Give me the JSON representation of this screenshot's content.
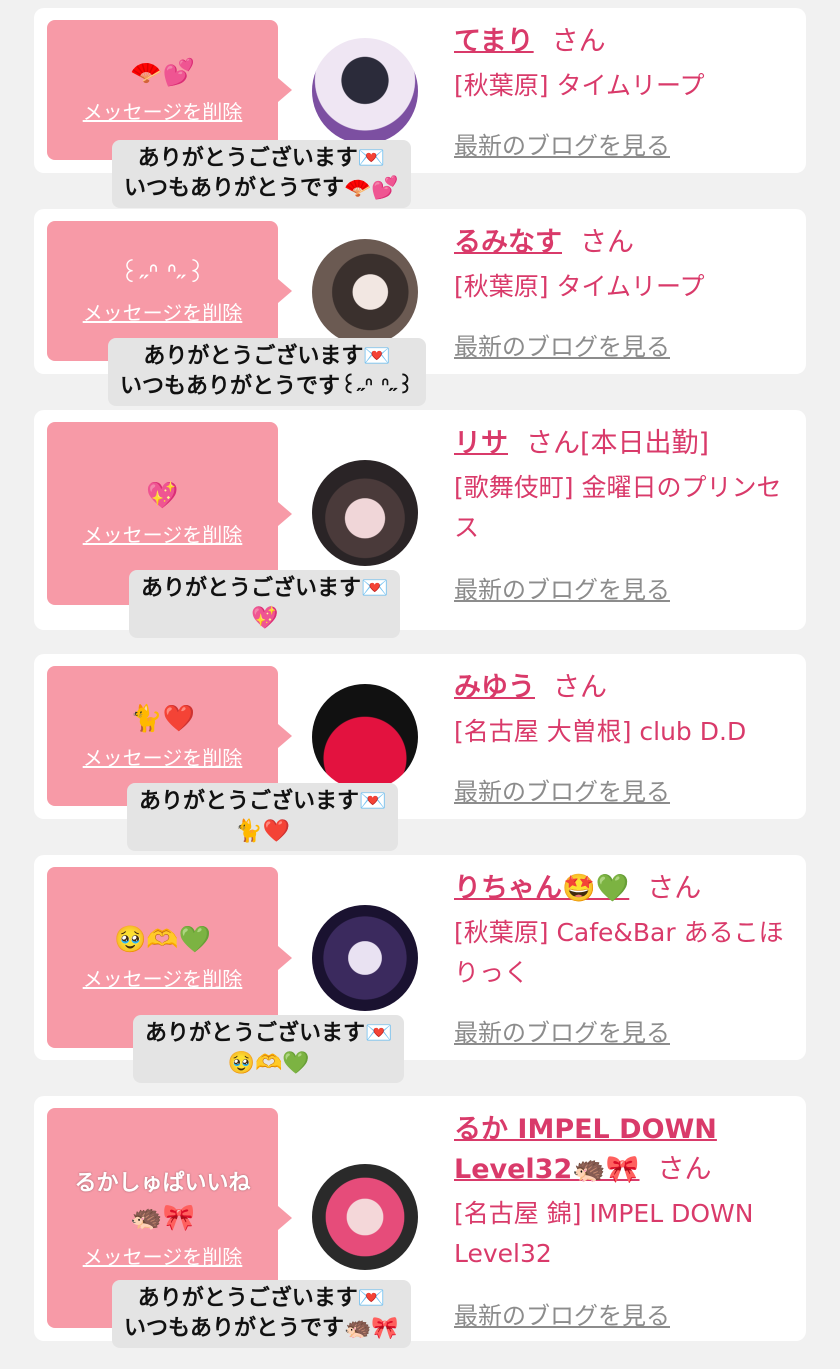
{
  "common": {
    "delete_label": "メッセージを削除",
    "blog_label": "最新のブログを見る",
    "san_suffix": "さん"
  },
  "cards": [
    {
      "name": "てまり",
      "status": "",
      "shop": "[秋葉原] タイムリープ",
      "message": "🪭💕",
      "reply_line1": "ありがとうございます💌",
      "reply_line2": "いつもありがとうです🪭💕"
    },
    {
      "name": "るみなす",
      "status": "",
      "shop": "[秋葉原] タイムリープ",
      "message": "꒰˶ᐢ ᐢ˶꒱",
      "reply_line1": "ありがとうございます💌",
      "reply_line2": "いつもありがとうです꒰˶ᐢ ᐢ˶꒱"
    },
    {
      "name": "リサ",
      "status": "[本日出勤]",
      "shop": "[歌舞伎町] 金曜日のプリンセス",
      "message": "💖",
      "reply_line1": "ありがとうございます💌",
      "reply_line2": "💖"
    },
    {
      "name": "みゆう",
      "status": "",
      "shop": "[名古屋 大曽根] club D.D",
      "message": "🐈❤️",
      "reply_line1": "ありがとうございます💌",
      "reply_line2": "🐈❤️"
    },
    {
      "name": "りちゃん🤩💚",
      "status": "",
      "shop": "[秋葉原] Cafe&Bar あるこほりっく",
      "message": "🥹🫶💚",
      "reply_line1": "ありがとうございます💌",
      "reply_line2": "🥹🫶💚"
    },
    {
      "name": "るか IMPEL DOWN Level32🦔🎀",
      "status": "",
      "shop": "[名古屋 錦] IMPEL DOWN Level32",
      "message_text": "るかしゅぱいいね",
      "message": "🦔🎀",
      "reply_line1": "ありがとうございます💌",
      "reply_line2": "いつもありがとうです🦔🎀"
    }
  ],
  "colors": {
    "background": "#f1f1f1",
    "bubble": "#f79aa7",
    "accent": "#d93a6a",
    "link_gray": "#8c8c8c",
    "reply_bg": "#e4e4e4"
  }
}
